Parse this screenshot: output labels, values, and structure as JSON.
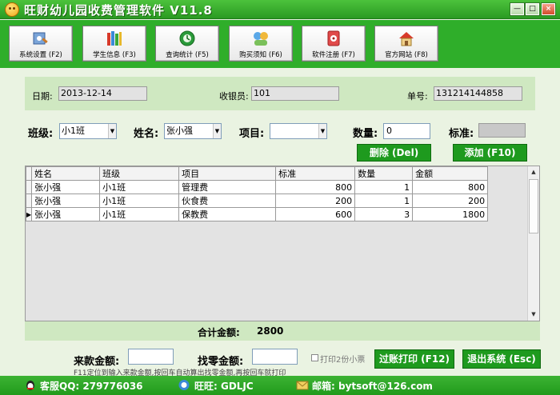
{
  "window": {
    "title": "旺财幼儿园收费管理软件 V11.8",
    "controls": [
      "—",
      "□",
      "×"
    ]
  },
  "toolbar": {
    "buttons": [
      {
        "label": "系统设置 (F2)",
        "icon": "settings-icon"
      },
      {
        "label": "学生信息 (F3)",
        "icon": "books-icon"
      },
      {
        "label": "查询统计 (F5)",
        "icon": "query-icon"
      },
      {
        "label": "购买须知 (F6)",
        "icon": "purchase-info-icon"
      },
      {
        "label": "软件注册 (F7)",
        "icon": "register-icon"
      },
      {
        "label": "官方网站 (F8)",
        "icon": "home-icon"
      }
    ]
  },
  "info": {
    "date_label": "日期:",
    "date_value": "2013-12-14",
    "cashier_label": "收银员:",
    "cashier_value": "101",
    "order_label": "单号:",
    "order_value": "131214144858"
  },
  "entry": {
    "class_label": "班级:",
    "class_value": "小1班",
    "name_label": "姓名:",
    "name_value": "张小强",
    "item_label": "项目:",
    "item_value": "",
    "qty_label": "数量:",
    "qty_value": "0",
    "standard_label": "标准:",
    "standard_value": "",
    "delete_button": "删除 (Del)",
    "add_button": "添加 (F10)"
  },
  "grid": {
    "columns": [
      "姓名",
      "班级",
      "项目",
      "标准",
      "数量",
      "金额"
    ],
    "rows": [
      [
        "张小强",
        "小1班",
        "管理费",
        "800",
        "1",
        "800"
      ],
      [
        "张小强",
        "小1班",
        "伙食费",
        "200",
        "1",
        "200"
      ],
      [
        "张小强",
        "小1班",
        "保教费",
        "600",
        "3",
        "1800"
      ]
    ],
    "current_row_marker": "▶"
  },
  "total": {
    "label": "合计金额:",
    "value": "2800"
  },
  "payment": {
    "received_label": "来款金额:",
    "received_value": "",
    "change_label": "找零金额:",
    "change_value": "",
    "print_two_label": "打印2份小票",
    "hint": "F11定位到输入来款金额,按回车自动算出找零金额,再按回车就打印",
    "checkout_button": "过账打印 (F12)",
    "exit_button": "退出系统 (Esc)"
  },
  "status": {
    "qq": "客服QQ: 279776036",
    "wangwang": "旺旺: GDLJC",
    "email": "邮箱: bytsoft@126.com"
  },
  "colors": {
    "titlebar": "#2a9a22",
    "toolbar": "#2fae2a",
    "panel": "#cfe8c1",
    "button_green": "#1e9a1e"
  }
}
